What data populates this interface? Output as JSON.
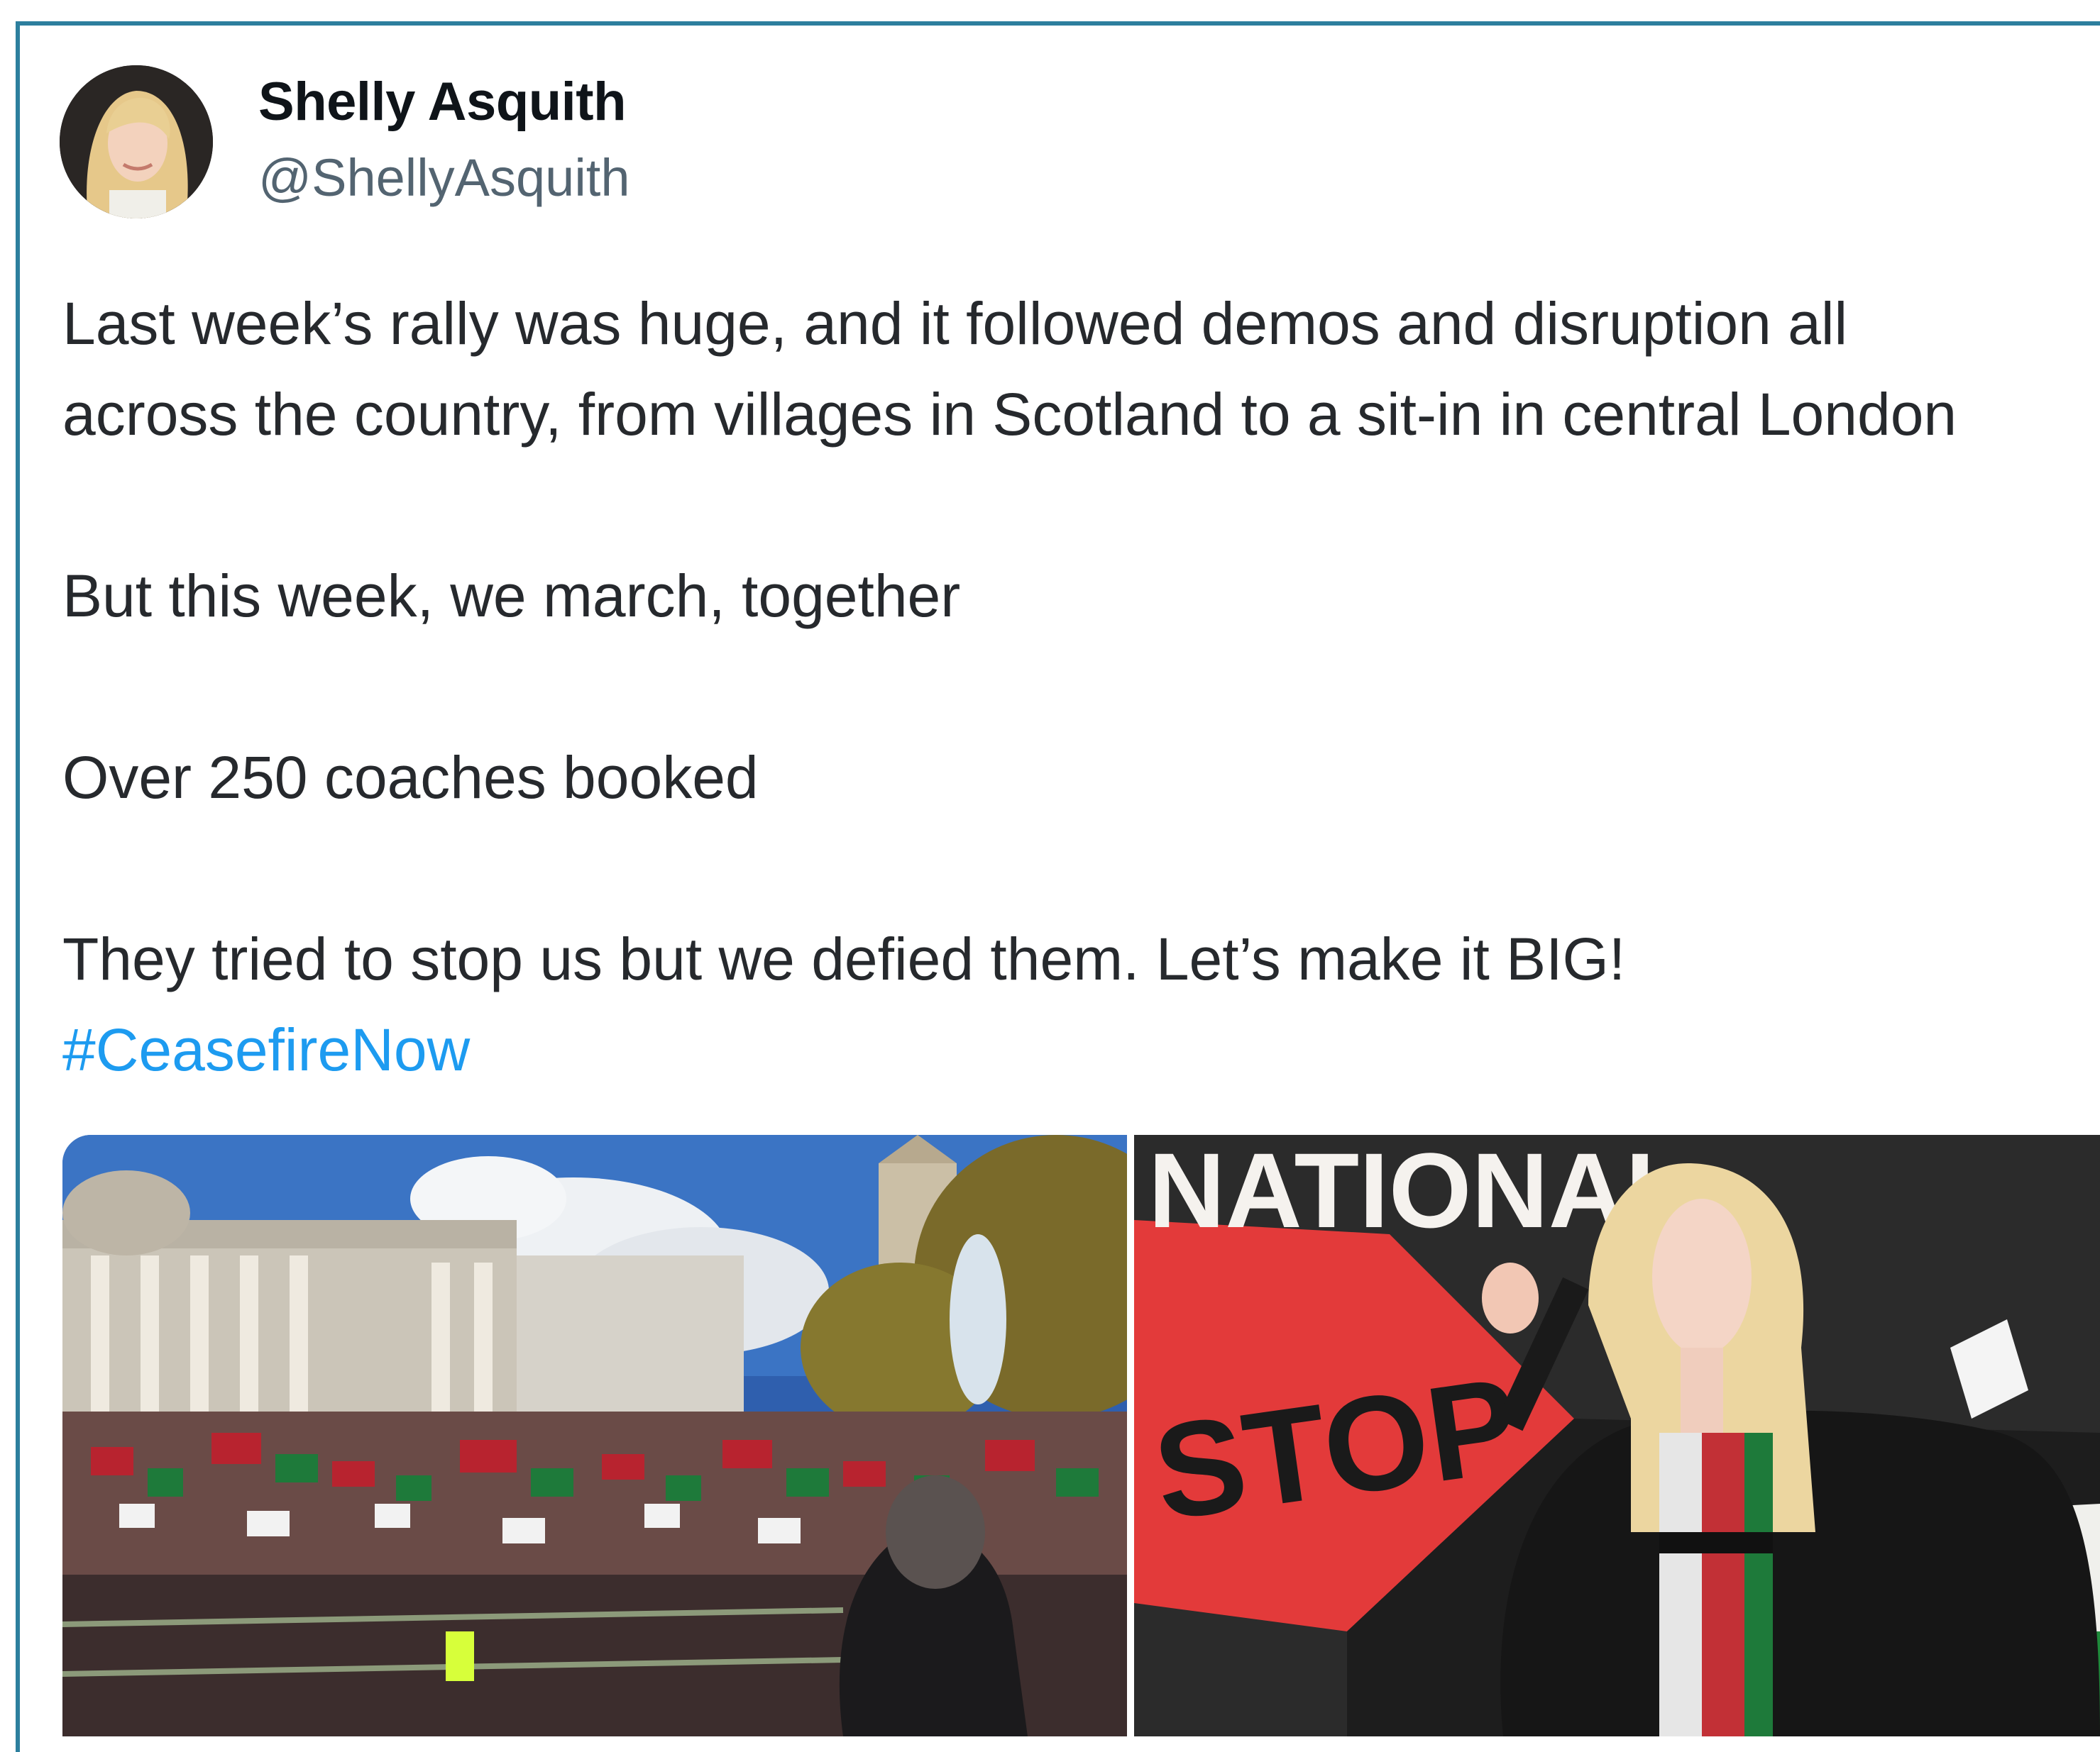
{
  "tweet": {
    "author": {
      "display_name": "Shelly Asquith",
      "handle": "@ShellyAsquith"
    },
    "text_lines": [
      "Last week’s rally was huge, and it followed demos and disruption all",
      "across the country, from villages in Scotland to a sit-in in central London",
      "But this week, we march, together",
      "Over 250 coaches booked",
      "They tried to stop us but we defied them. Let’s make it BIG!"
    ],
    "hashtag": "#CeasefireNow",
    "media": {
      "photo2_banner_top": "NATIONAL",
      "photo2_banner_stop": "STOP"
    }
  },
  "colors": {
    "frame_border": "#2d7f9e",
    "hashtag": "#1d9bf0",
    "handle": "#536471"
  }
}
